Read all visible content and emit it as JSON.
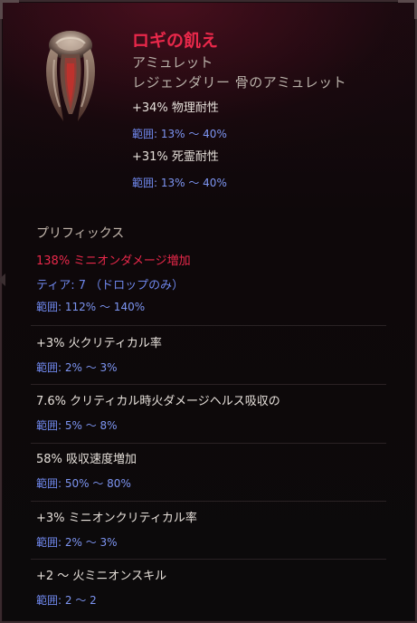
{
  "item": {
    "name": "ロギの飢え",
    "type": "アミュレット",
    "subtype": "レジェンダリー 骨のアミュレット"
  },
  "implicits": [
    {
      "stat": "+34% 物理耐性",
      "range_label": "範囲",
      "range_value": ": 13% 〜 40%"
    },
    {
      "stat": "+31% 死霊耐性",
      "range_label": "範囲",
      "range_value": ": 13% 〜 40%"
    }
  ],
  "section_title": "プリフィックス",
  "prefix": {
    "stat": "138% ミニオンダメージ増加",
    "tier_label": "ティア",
    "tier_value": ": 7 （ドロップのみ）",
    "range_label": "範囲",
    "range_value": ": 112% 〜 140%"
  },
  "affixes": [
    {
      "stat": "+3% 火クリティカル率",
      "range_label": "範囲",
      "range_value": ": 2% 〜 3%"
    },
    {
      "stat": "7.6% クリティカル時火ダメージヘルス吸収の",
      "range_label": "範囲",
      "range_value": ": 5% 〜 8%"
    },
    {
      "stat": "58% 吸収速度増加",
      "range_label": "範囲",
      "range_value": ": 50% 〜 80%"
    },
    {
      "stat": "+3% ミニオンクリティカル率",
      "range_label": "範囲",
      "range_value": ": 2% 〜 3%"
    },
    {
      "stat": "+2 〜 火ミニオンスキル",
      "range_label": "範囲",
      "range_value": ": 2 〜 2"
    }
  ],
  "colors": {
    "legendary_red": "#e8284a",
    "range_blue": "#6e86ea",
    "stat_white": "#e6e0da",
    "type_grey": "#b8b0a8"
  },
  "icons": {
    "item_art": "bone-amulet-icon"
  }
}
